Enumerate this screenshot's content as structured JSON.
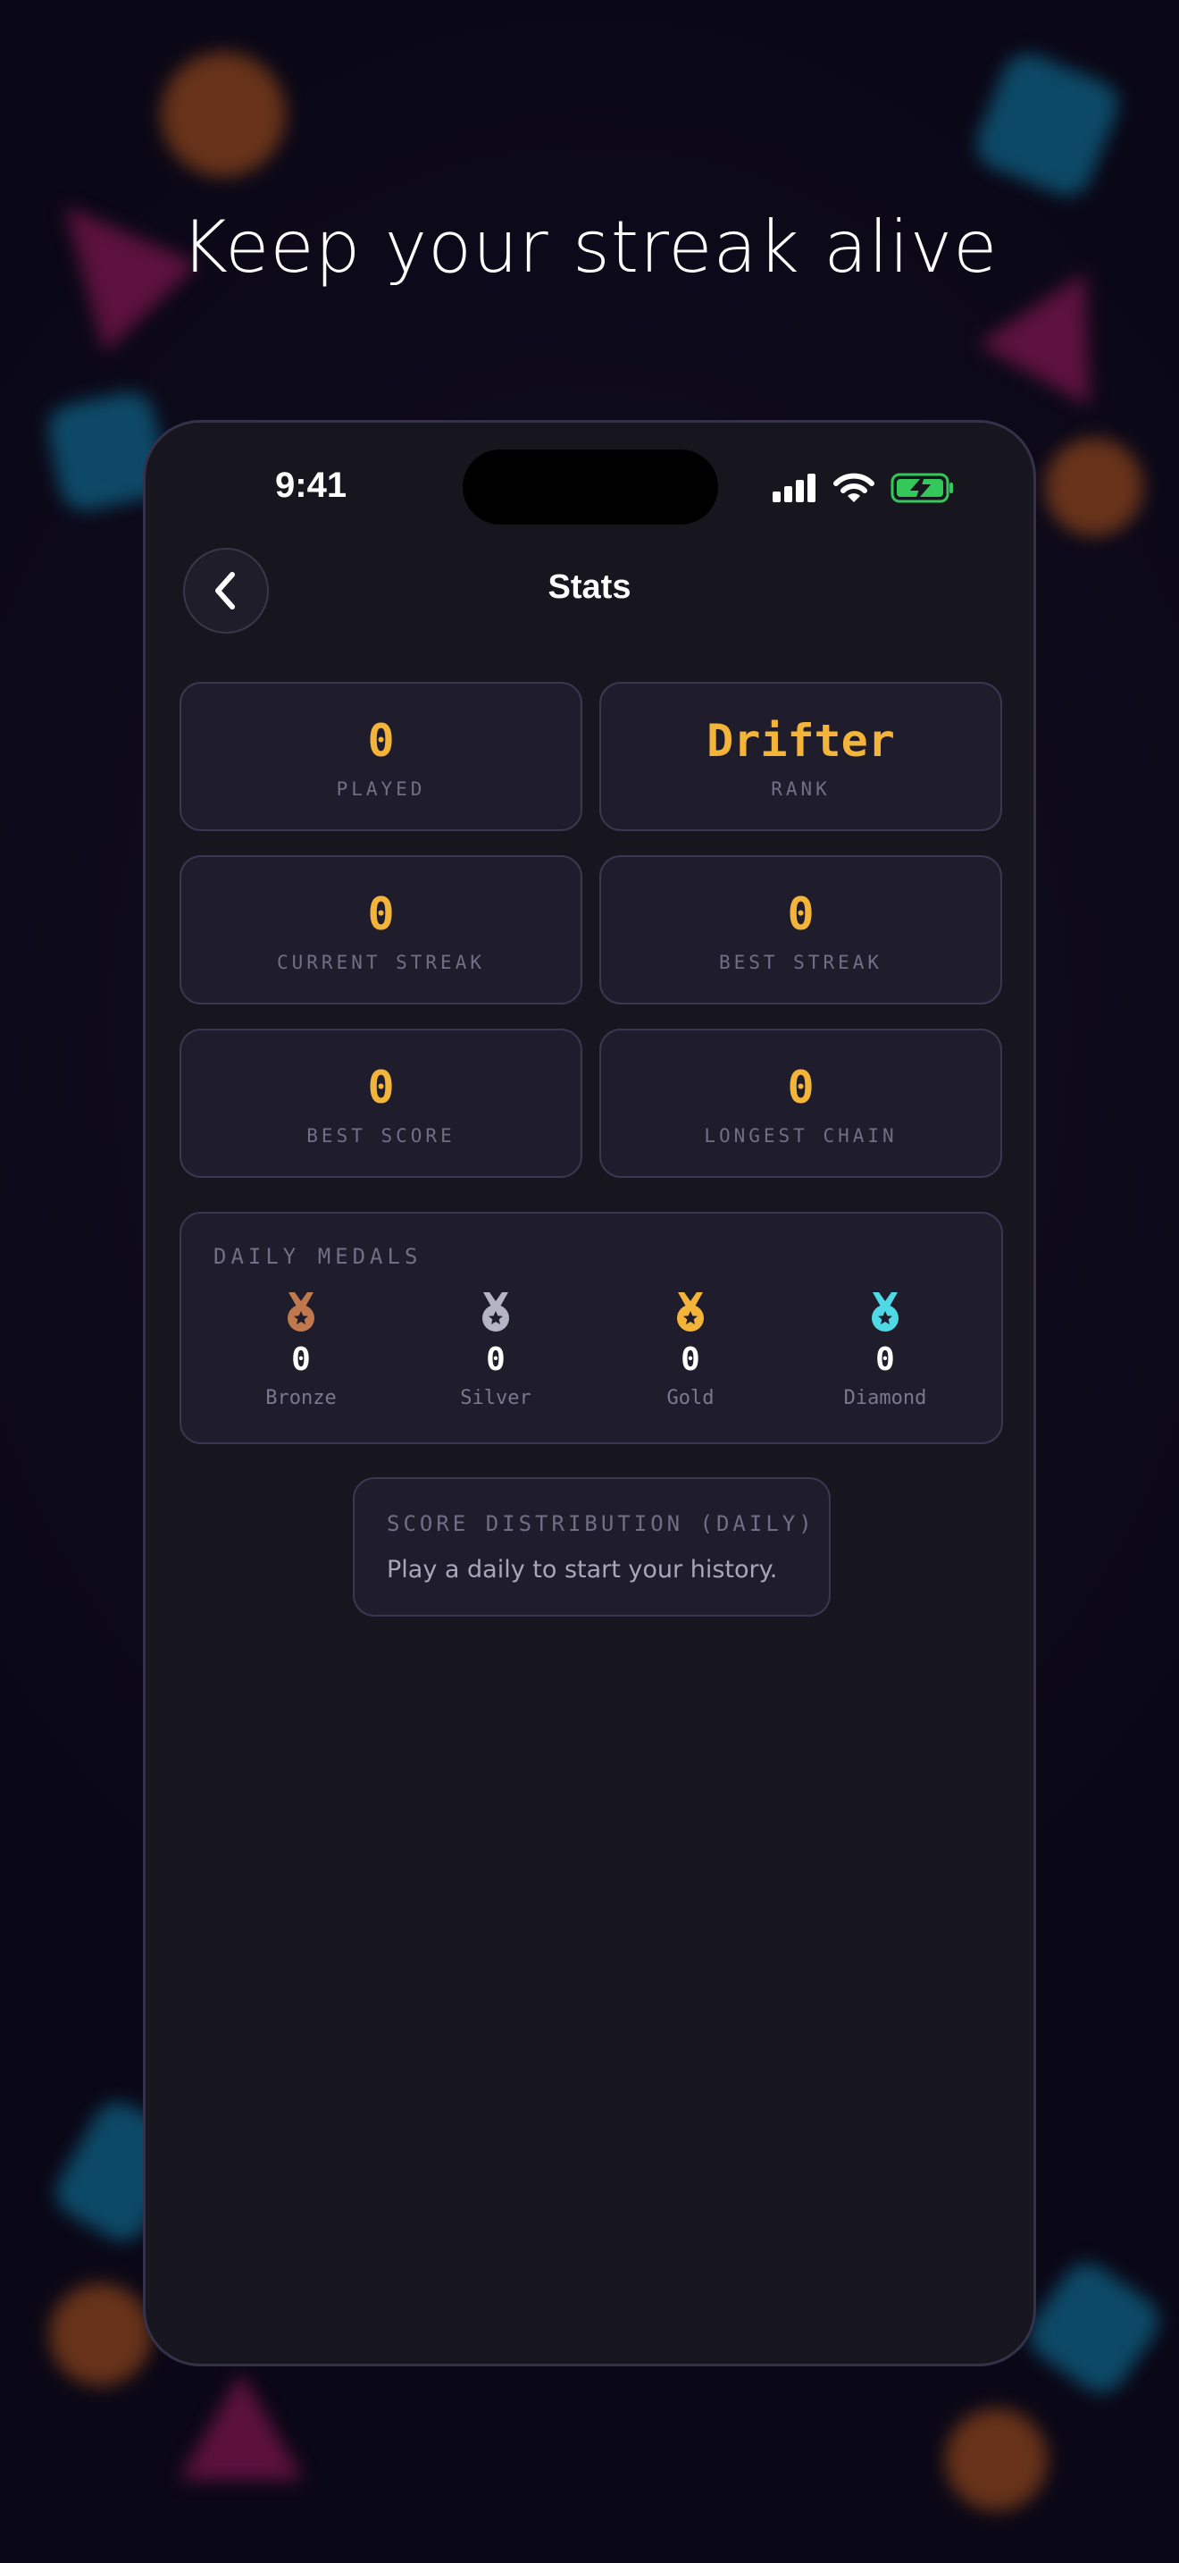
{
  "hero": {
    "title": "Keep your streak alive"
  },
  "status_bar": {
    "time": "9:41"
  },
  "nav": {
    "title": "Stats"
  },
  "stats": [
    {
      "value": "0",
      "label": "PLAYED"
    },
    {
      "value": "Drifter",
      "label": "RANK"
    },
    {
      "value": "0",
      "label": "CURRENT STREAK"
    },
    {
      "value": "0",
      "label": "BEST STREAK"
    },
    {
      "value": "0",
      "label": "BEST SCORE"
    },
    {
      "value": "0",
      "label": "LONGEST CHAIN"
    }
  ],
  "medals": {
    "heading": "DAILY MEDALS",
    "items": [
      {
        "name": "Bronze",
        "count": "0",
        "color": "#c0794f"
      },
      {
        "name": "Silver",
        "count": "0",
        "color": "#b5b4c4"
      },
      {
        "name": "Gold",
        "count": "0",
        "color": "#f4b43a"
      },
      {
        "name": "Diamond",
        "count": "0",
        "color": "#4fd8e6"
      }
    ]
  },
  "distribution": {
    "heading": "SCORE DISTRIBUTION (DAILY)",
    "empty_text": "Play a daily to start your history."
  },
  "colors": {
    "accent": "#f4b43a",
    "battery": "#34c759"
  },
  "icons": [
    "back-chevron-icon",
    "cellular-signal-icon",
    "wifi-icon",
    "battery-charging-icon",
    "medal-icon"
  ]
}
